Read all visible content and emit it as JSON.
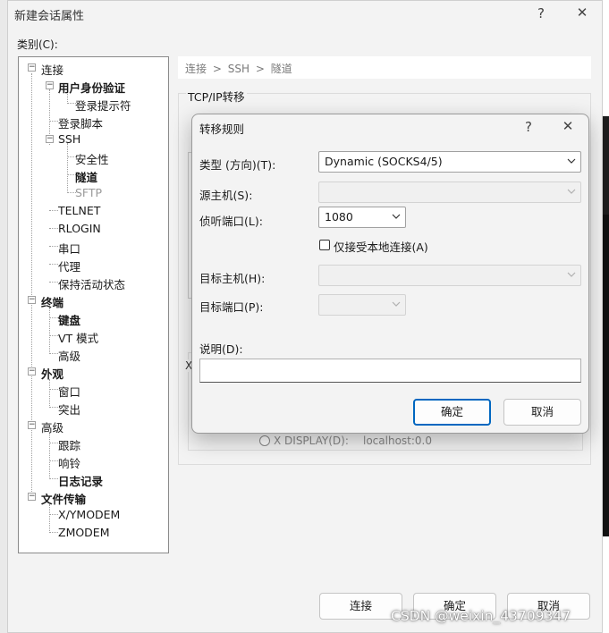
{
  "main_window": {
    "title": "新建会话属性",
    "help_button": "?",
    "close_button": "✕",
    "category_label": "类别(C):"
  },
  "tree": {
    "items": [
      {
        "label": "连接",
        "bold": true
      },
      {
        "label": "用户身份验证",
        "bold": true
      },
      {
        "label": "登录提示符"
      },
      {
        "label": "登录脚本"
      },
      {
        "label": "SSH"
      },
      {
        "label": "安全性"
      },
      {
        "label": "隧道",
        "bold": true
      },
      {
        "label": "SFTP",
        "gray": true
      },
      {
        "label": "TELNET"
      },
      {
        "label": "RLOGIN"
      },
      {
        "label": "串口"
      },
      {
        "label": "代理"
      },
      {
        "label": "保持活动状态"
      },
      {
        "label": "终端",
        "bold": true
      },
      {
        "label": "键盘",
        "bold": true
      },
      {
        "label": "VT 模式"
      },
      {
        "label": "高级"
      },
      {
        "label": "外观",
        "bold": true
      },
      {
        "label": "窗口"
      },
      {
        "label": "突出"
      },
      {
        "label": "高级"
      },
      {
        "label": "跟踪"
      },
      {
        "label": "响铃"
      },
      {
        "label": "日志记录",
        "bold": true
      },
      {
        "label": "文件传输",
        "bold": true
      },
      {
        "label": "X/YMODEM"
      },
      {
        "label": "ZMODEM"
      }
    ]
  },
  "breadcrumb": {
    "part1": "连接",
    "sep": ">",
    "part2": "SSH",
    "part3": "隧道"
  },
  "right_panel": {
    "section_title": "TCP/IP转移",
    "x_display_label": "X DISPLAY(D):",
    "x_display_value": "localhost:0.0"
  },
  "bottom_buttons": {
    "connect": "连接",
    "ok": "确定",
    "cancel": "取消"
  },
  "dialog": {
    "title": "转移规则",
    "help_button": "?",
    "close_button": "✕",
    "type_label": "类型 (方向)(T):",
    "type_value": "Dynamic (SOCKS4/5)",
    "source_host_label": "源主机(S):",
    "source_host_value": "",
    "listen_port_label": "侦听端口(L):",
    "listen_port_value": "1080",
    "local_only_label": "仅接受本地连接(A)",
    "local_only_checked": false,
    "target_host_label": "目标主机(H):",
    "target_host_value": "",
    "target_port_label": "目标端口(P):",
    "target_port_value": "",
    "description_label": "说明(D):",
    "description_value": "",
    "ok_button": "确定",
    "cancel_button": "取消"
  },
  "watermark": "CSDN @weixin_43709347"
}
